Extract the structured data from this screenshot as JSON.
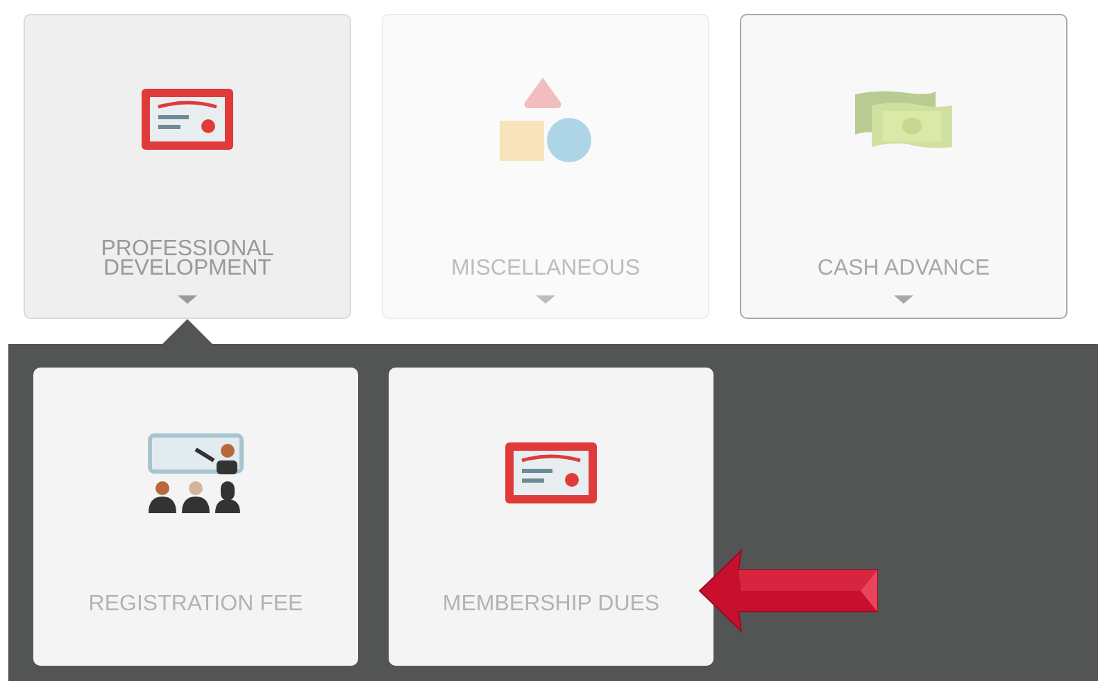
{
  "categories": [
    {
      "label": "PROFESSIONAL DEVELOPMENT",
      "kind": "certificate",
      "selected": true,
      "disabled": false,
      "focused": false
    },
    {
      "label": "MISCELLANEOUS",
      "kind": "shapes",
      "selected": false,
      "disabled": true,
      "focused": false
    },
    {
      "label": "CASH ADVANCE",
      "kind": "money",
      "selected": false,
      "disabled": false,
      "focused": true
    }
  ],
  "subcategories": [
    {
      "label": "REGISTRATION FEE",
      "kind": "presenter",
      "highlighted": false
    },
    {
      "label": "MEMBERSHIP DUES",
      "kind": "certificate",
      "highlighted": true
    }
  ]
}
